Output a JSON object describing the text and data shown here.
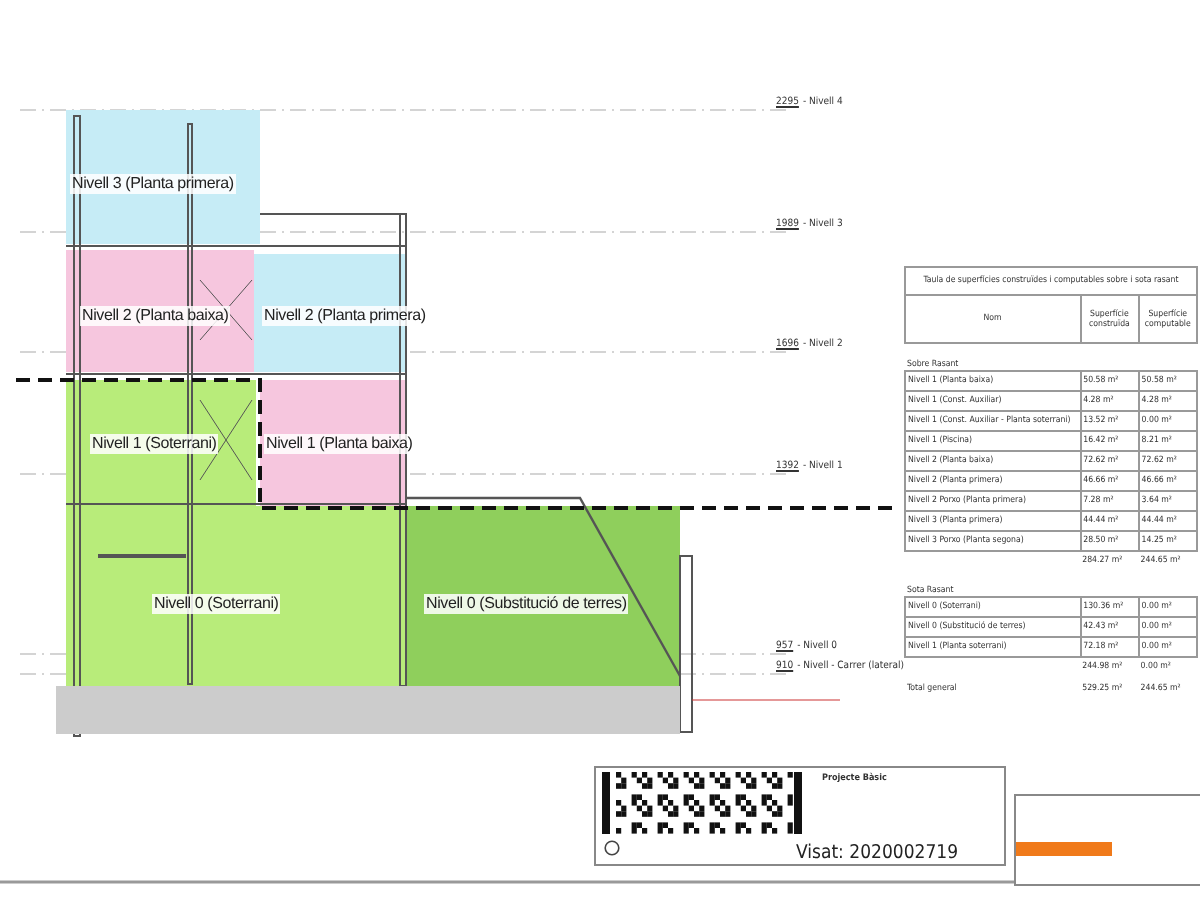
{
  "levels": [
    {
      "elevation": "2295",
      "name": "- Nivell 4"
    },
    {
      "elevation": "1989",
      "name": "- Nivell 3"
    },
    {
      "elevation": "1696",
      "name": "- Nivell 2"
    },
    {
      "elevation": "1392",
      "name": "- Nivell 1"
    },
    {
      "elevation": "957",
      "name": "- Nivell 0"
    },
    {
      "elevation": "910",
      "name": "- Nivell - Carrer (lateral)"
    }
  ],
  "zones": [
    {
      "label": "Nivell 3 (Planta primera)",
      "color": "#c6ecf6"
    },
    {
      "label": "Nivell 2 (Planta baixa)",
      "color": "#f6c6de"
    },
    {
      "label": "Nivell 2 (Planta primera)",
      "color": "#c6ecf6"
    },
    {
      "label": "Nivell 1 (Soterrani)",
      "color": "#b8ec7a"
    },
    {
      "label": "Nivell 1 (Planta baixa)",
      "color": "#f6c6de"
    },
    {
      "label": "Nivell 0 (Soterrani)",
      "color": "#b8ec7a"
    },
    {
      "label": "Nivell 0 (Substitució de terres)",
      "color": "#8fcf5c"
    }
  ],
  "table": {
    "title": "Taula de superfícies construïdes i computables sobre i sota rasant",
    "columns": [
      "Nom",
      "Superfície construïda",
      "Superfície computable"
    ],
    "sections": [
      {
        "title": "Sobre Rasant",
        "rows": [
          [
            "Nivell 1 (Planta baixa)",
            "50.58 m²",
            "50.58 m²"
          ],
          [
            "Nivell 1 (Const. Auxiliar)",
            "4.28 m²",
            "4.28 m²"
          ],
          [
            "Nivell 1 (Const. Auxiliar - Planta soterrani)",
            "13.52 m²",
            "0.00 m²"
          ],
          [
            "Nivell 1 (Piscina)",
            "16.42 m²",
            "8.21 m²"
          ],
          [
            "Nivell 2 (Planta baixa)",
            "72.62 m²",
            "72.62 m²"
          ],
          [
            "Nivell 2 (Planta primera)",
            "46.66 m²",
            "46.66 m²"
          ],
          [
            "Nivell 2 Porxo (Planta primera)",
            "7.28 m²",
            "3.64 m²"
          ],
          [
            "Nivell 3 (Planta primera)",
            "44.44 m²",
            "44.44 m²"
          ],
          [
            "Nivell 3 Porxo (Planta segona)",
            "28.50 m²",
            "14.25 m²"
          ]
        ],
        "subtotal": [
          "284.27 m²",
          "244.65 m²"
        ]
      },
      {
        "title": "Sota Rasant",
        "rows": [
          [
            "Nivell 0 (Soterrani)",
            "130.36 m²",
            "0.00 m²"
          ],
          [
            "Nivell 0 (Substitució de terres)",
            "42.43 m²",
            "0.00 m²"
          ],
          [
            "Nivell 1 (Planta soterrani)",
            "72.18 m²",
            "0.00 m²"
          ]
        ],
        "subtotal": [
          "244.98 m²",
          "0.00 m²"
        ]
      }
    ],
    "total": {
      "label": "Total general",
      "values": [
        "529.25 m²",
        "244.65 m²"
      ]
    }
  },
  "stamp": {
    "heading": "Projecte Bàsic",
    "visa": "Visat: 2020002719"
  }
}
